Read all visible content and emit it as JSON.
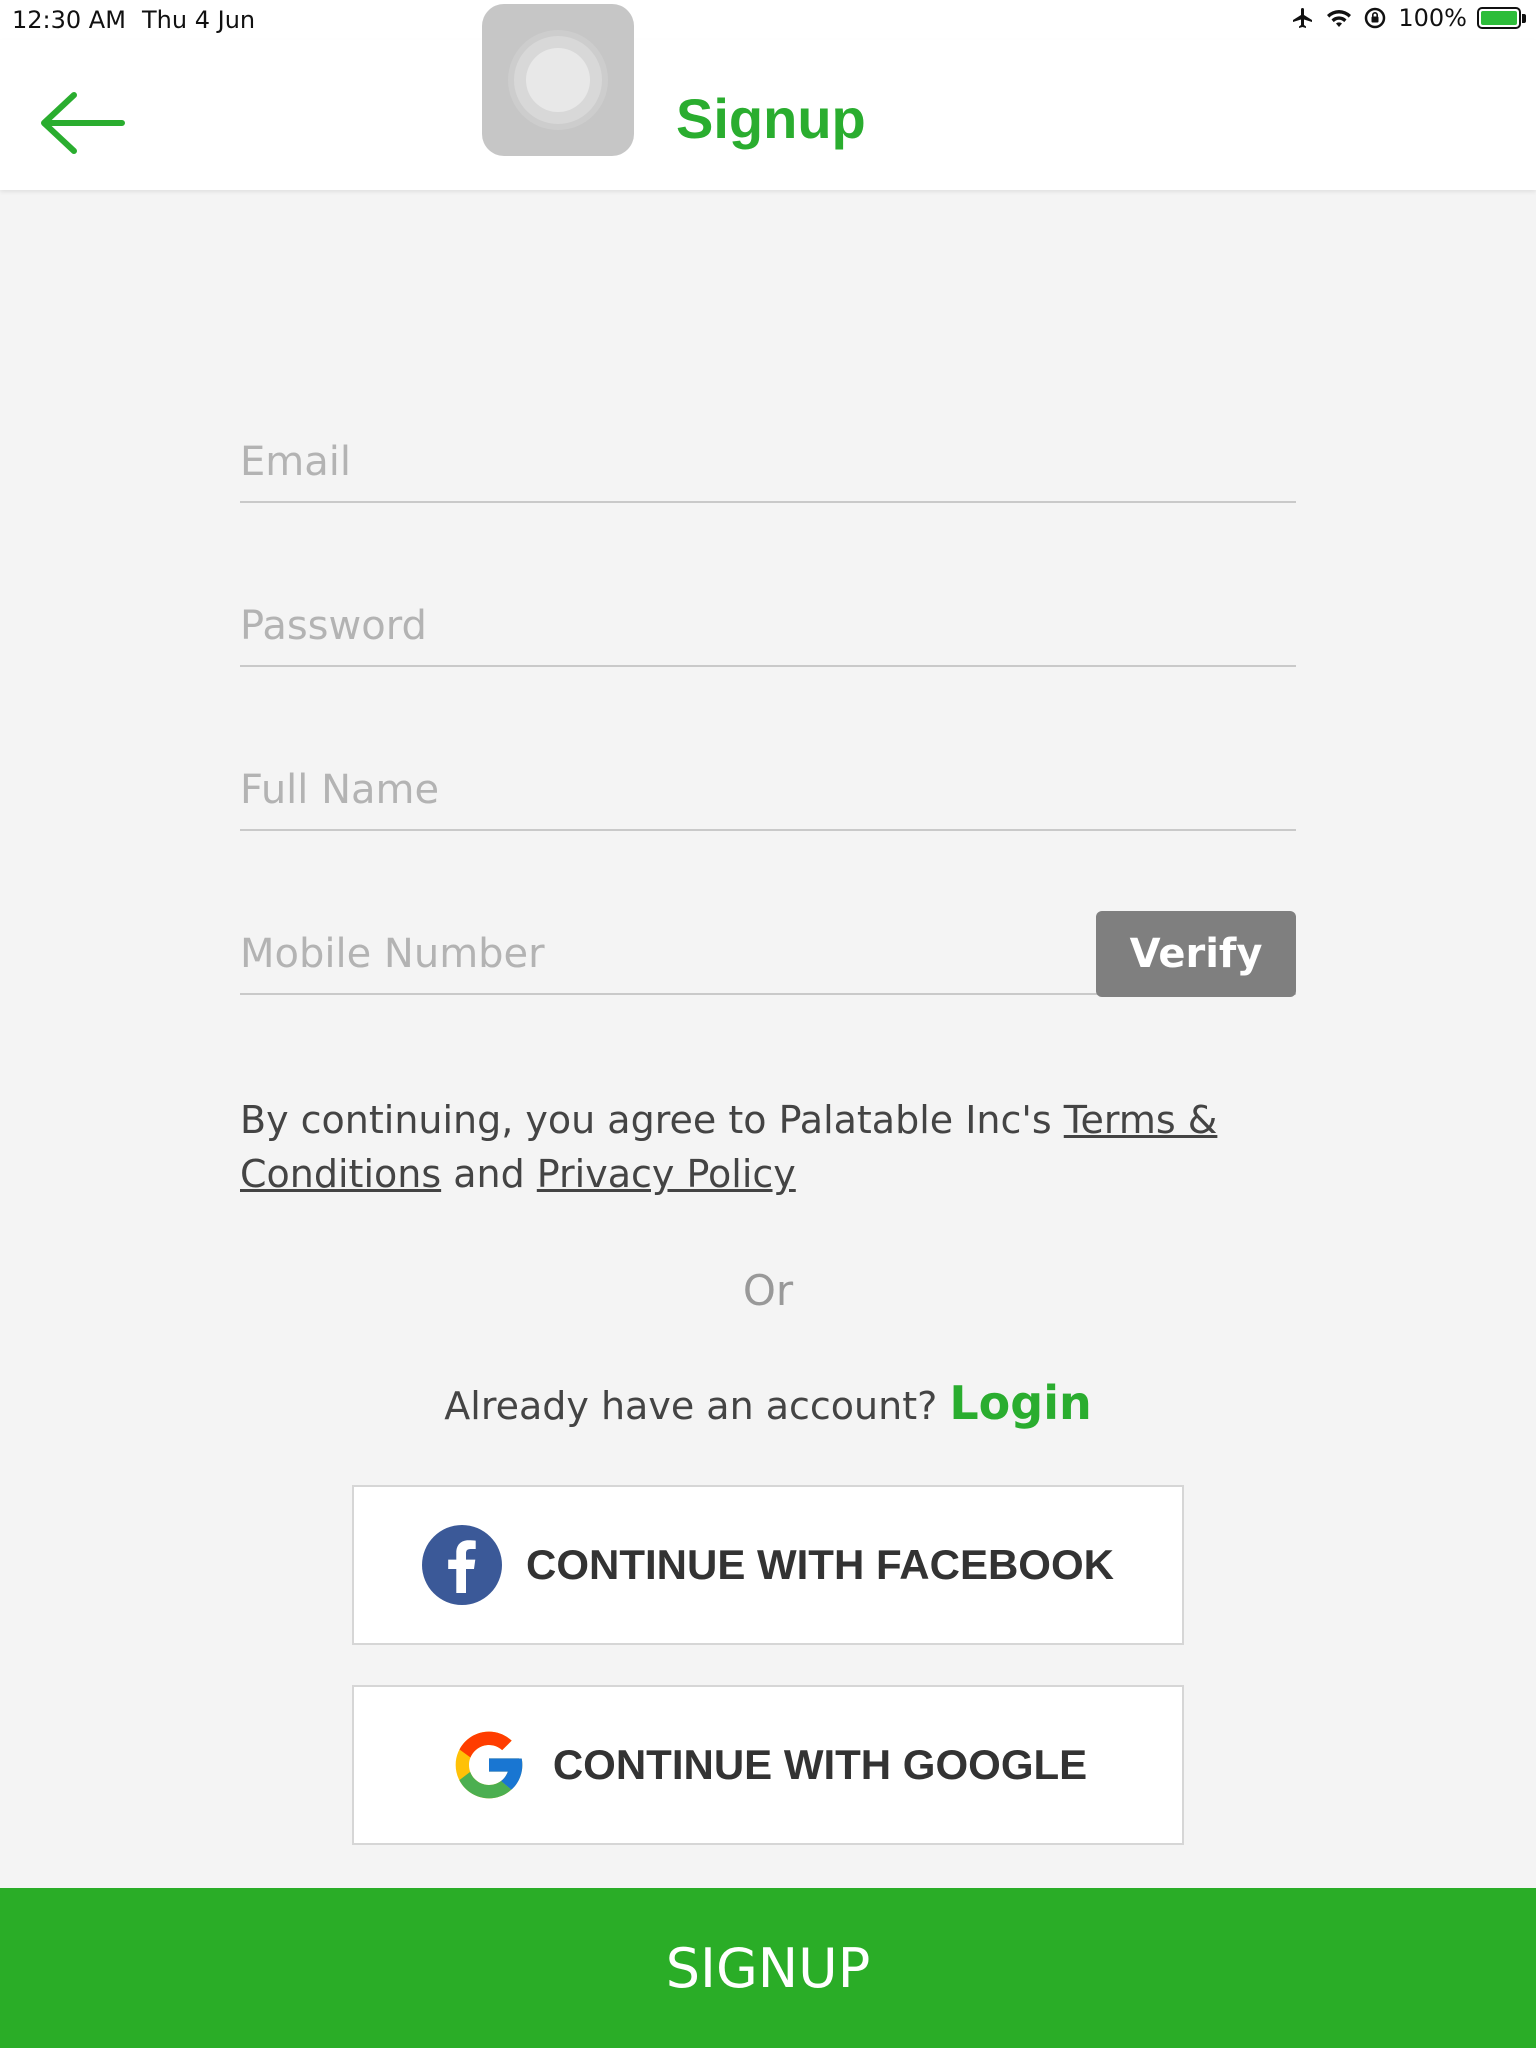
{
  "status_bar": {
    "time": "12:30 AM",
    "date": "Thu 4 Jun",
    "battery": "100%",
    "icons": [
      "airplane-icon",
      "wifi-icon",
      "orientation-lock-icon",
      "battery-icon"
    ]
  },
  "header": {
    "title": "Signup",
    "back_icon": "arrow-left-icon"
  },
  "form": {
    "email_placeholder": "Email",
    "password_placeholder": "Password",
    "fullname_placeholder": "Full Name",
    "mobile_placeholder": "Mobile Number",
    "verify_label": "Verify"
  },
  "terms": {
    "prefix": "By continuing, you agree to Palatable Inc's ",
    "terms_link": "Terms & Conditions",
    "middle": " and ",
    "privacy_link": "Privacy Policy"
  },
  "or_label": "Or",
  "login_prompt": {
    "text": "Already have an account? ",
    "link": "Login"
  },
  "social": {
    "facebook_label": "CONTINUE WITH FACEBOOK",
    "google_label": "CONTINUE WITH GOOGLE"
  },
  "signup_button": "SIGNUP",
  "colors": {
    "brand_green": "#2aad2f",
    "verify_gray": "#7f7f7f",
    "facebook_blue": "#3b5998"
  }
}
